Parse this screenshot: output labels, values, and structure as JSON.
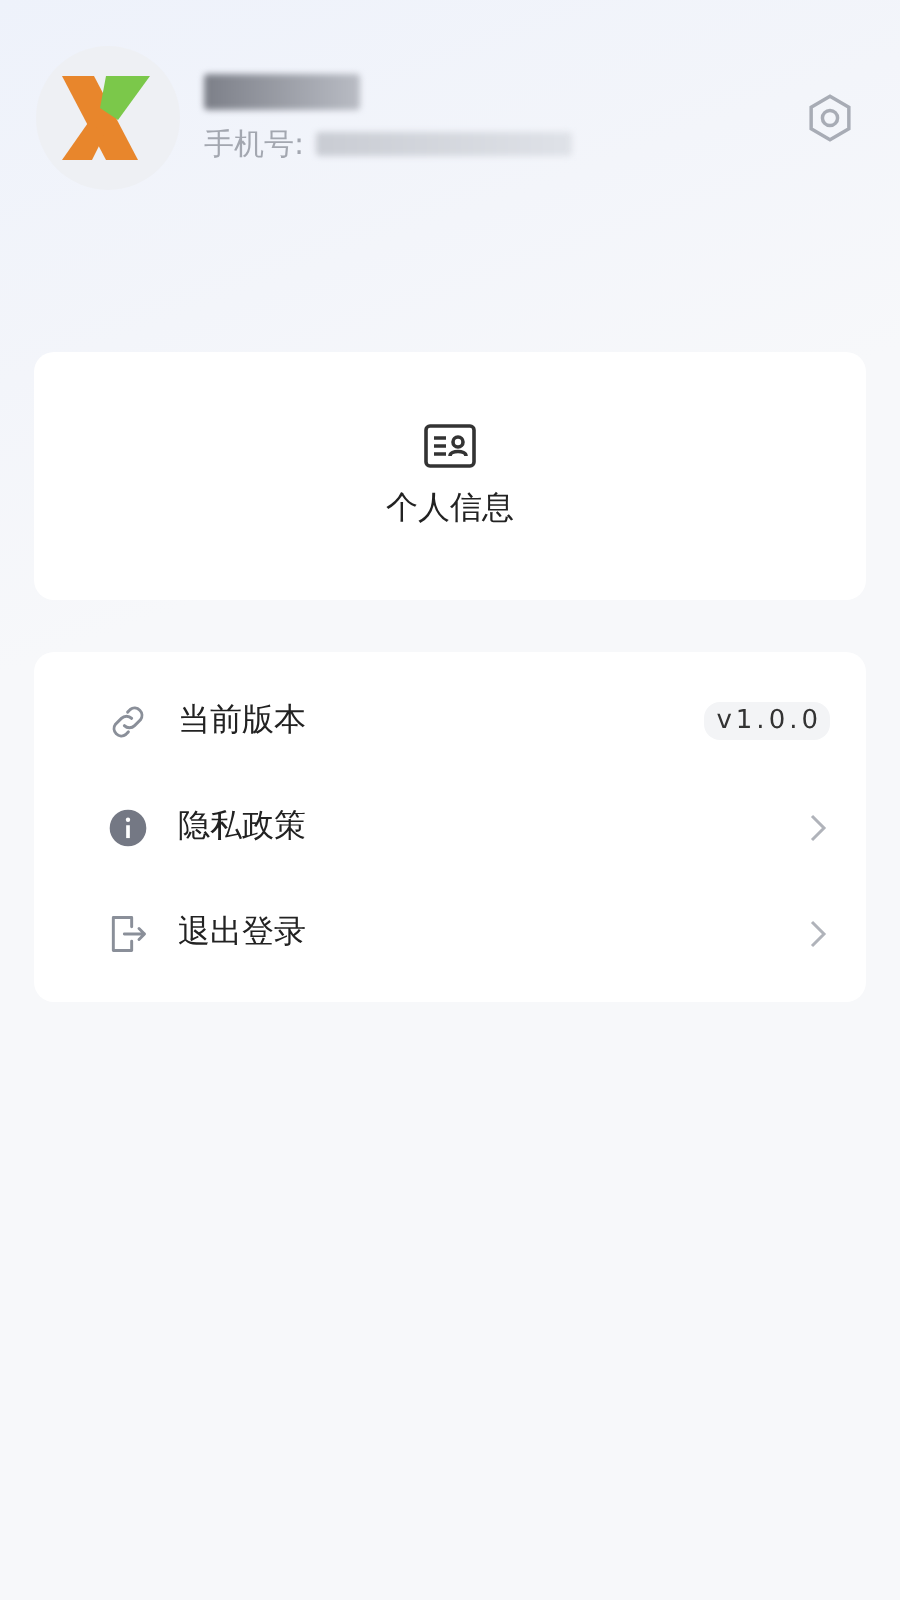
{
  "profile": {
    "phone_label": "手机号:"
  },
  "card": {
    "label": "个人信息"
  },
  "menu": [
    {
      "kind": "value",
      "label": "当前版本",
      "value": "v1.0.0"
    },
    {
      "kind": "link",
      "label": "隐私政策"
    },
    {
      "kind": "link",
      "label": "退出登录"
    }
  ]
}
